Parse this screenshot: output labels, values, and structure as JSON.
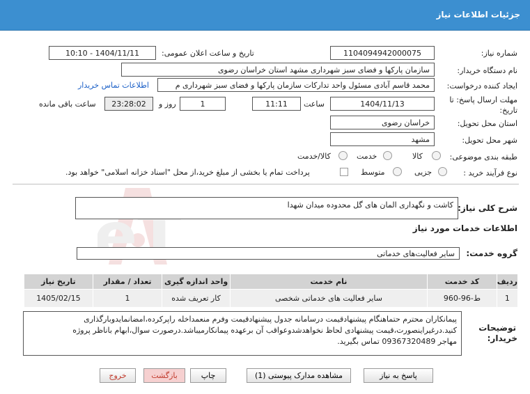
{
  "header": {
    "title": "جزئیات اطلاعات نیاز"
  },
  "form": {
    "need_number_label": "شماره نیاز:",
    "need_number": "1104094942000075",
    "announce_label": "تاریخ و ساعت اعلان عمومی:",
    "announce_value": "1404/11/11 - 10:10",
    "buyer_org_label": "نام دستگاه خریدار:",
    "buyer_org": "سازمان پارکها و فضای سبز شهرداری مشهد استان خراسان رضوی",
    "creator_label": "ایجاد کننده درخواست:",
    "creator": "محمد قاسم آبادی مسئول واحد تدارکات سازمان پارکها و فضای سبز شهرداری م",
    "contact_link": "اطلاعات تماس خریدار",
    "deadline_label_1": "مهلت ارسال پاسخ: تا",
    "deadline_label_2": "تاریخ:",
    "deadline_date": "1404/11/13",
    "time_label": "ساعت",
    "deadline_time": "11:11",
    "days_value": "1",
    "days_label": "روز و",
    "remaining_time": "23:28:02",
    "remaining_label": "ساعت باقی مانده",
    "province_label": "استان محل تحویل:",
    "province": "خراسان رضوی",
    "city_label": "شهر محل تحویل:",
    "city": "مشهد",
    "category_label": "طبقه بندی موضوعی:",
    "category_options": [
      "کالا",
      "خدمت",
      "کالا/خدمت"
    ],
    "process_label": "نوع فرآیند خرید :",
    "process_options": [
      "جزیی",
      "متوسط"
    ],
    "payment_note": "پرداخت تمام یا بخشی از مبلغ خرید،از محل \"اسناد خزانه اسلامی\" خواهد بود."
  },
  "summary": {
    "label": "شرح کلی نیاز:",
    "value": "کاشت و نگهداری المان های گل محدوده میدان شهدا"
  },
  "services": {
    "section_title": "اطلاعات خدمات مورد نیاز",
    "group_label": "گروه خدمت:",
    "group_value": "سایر فعالیت‌های خدماتی"
  },
  "table": {
    "headers": [
      "ردیف",
      "کد خدمت",
      "نام خدمت",
      "واحد اندازه گیری",
      "تعداد / مقدار",
      "تاریخ نیاز"
    ],
    "rows": [
      [
        "1",
        "ط-96-960",
        "سایر فعالیت های خدماتی شخصی",
        "کار تعریف شده",
        "1",
        "1405/02/15"
      ]
    ]
  },
  "notes": {
    "label_1": "توضیحات",
    "label_2": "خریدار:",
    "line1": "پیمانکاران محترم حتماهنگام پیشنهادقیمت درسامانه جدول پیشنهادقیمت وفرم منعمداخله راپرکرده،امضانمایدوبارگذاری",
    "line2": "کنید.درغیراینصورت،قیمت پیشنهادی لحاظ نخواهدشدوعواقب آن برعهده پیمانکارمیباشد.درصورت سوال،ابهام باناظر پروژه",
    "line3": "مهاجر 09367320489 تماس بگیرید."
  },
  "buttons": {
    "reply": "پاسخ به نیاز",
    "attachments": "مشاهده مدارک پیوستی (1)",
    "print": "چاپ",
    "back": "بازگشت",
    "exit": "خروج"
  },
  "watermark_text": "AriaTender.neT",
  "colors": {
    "header": "#3c8fd0",
    "link": "#1a5fc7",
    "exit_text": "#c0392b",
    "back_bg": "#f6d0d0"
  }
}
